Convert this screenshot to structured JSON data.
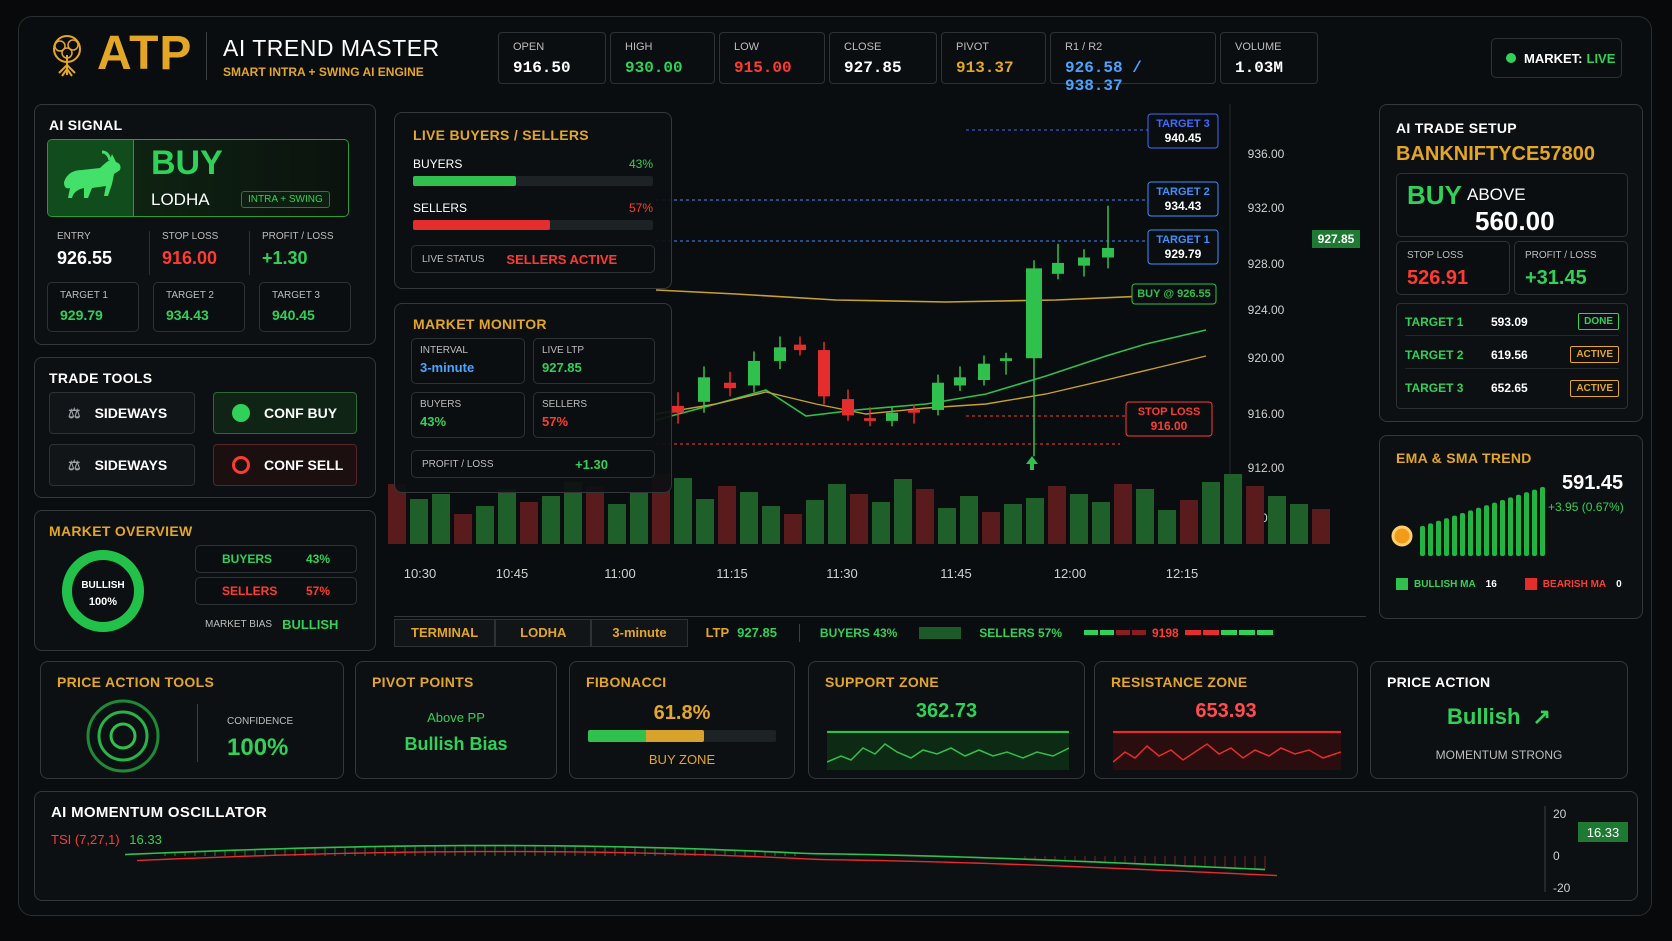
{
  "header": {
    "logo": "ATP",
    "title": "AI TREND MASTER",
    "subtitle": "SMART INTRA + SWING AI ENGINE",
    "stats": [
      {
        "label": "OPEN",
        "value": "916.50",
        "color": "#ffffff"
      },
      {
        "label": "HIGH",
        "value": "930.00",
        "color": "#30d158"
      },
      {
        "label": "LOW",
        "value": "915.00",
        "color": "#ff3b30"
      },
      {
        "label": "CLOSE",
        "value": "927.85",
        "color": "#ffffff"
      },
      {
        "label": "PIVOT",
        "value": "913.37",
        "color": "#e3a625"
      },
      {
        "label": "R1 / R2",
        "value": "926.58 / 938.37",
        "color": "#4aa3ff"
      },
      {
        "label": "VOLUME",
        "value": "1.03M",
        "color": "#ffffff"
      }
    ],
    "market_label": "MARKET:",
    "market_status": "LIVE"
  },
  "ai_signal": {
    "title": "AI SIGNAL",
    "signal": "BUY",
    "symbol": "LODHA",
    "mode": "INTRA + SWING",
    "entry_label": "ENTRY",
    "entry": "926.55",
    "sl_label": "STOP LOSS",
    "sl": "916.00",
    "pl_label": "PROFIT / LOSS",
    "pl": "+1.30",
    "targets": [
      {
        "label": "TARGET 1",
        "value": "929.79"
      },
      {
        "label": "TARGET 2",
        "value": "934.43"
      },
      {
        "label": "TARGET 3",
        "value": "940.45"
      }
    ]
  },
  "trade_tools": {
    "title": "TRADE TOOLS",
    "buttons": [
      "SIDEWAYS",
      "CONF BUY",
      "SIDEWAYS",
      "CONF SELL"
    ]
  },
  "market_overview": {
    "title": "MARKET OVERVIEW",
    "gauge_label": "BULLISH",
    "gauge_value": "100%",
    "gauge_fraction": 1.0,
    "buyers_label": "BUYERS",
    "buyers": "43%",
    "sellers_label": "SELLERS",
    "sellers": "57%",
    "bias_label": "MARKET BIAS",
    "bias": "BULLISH"
  },
  "live_bs": {
    "title": "LIVE BUYERS / SELLERS",
    "buyers_label": "BUYERS",
    "buyers": "43%",
    "buyers_fraction": 0.43,
    "sellers_label": "SELLERS",
    "sellers": "57%",
    "sellers_fraction": 0.57,
    "status_label": "LIVE STATUS",
    "status": "SELLERS ACTIVE"
  },
  "monitor": {
    "title": "MARKET MONITOR",
    "interval_label": "INTERVAL",
    "interval": "3-minute",
    "ltp_label": "LIVE LTP",
    "ltp": "927.85",
    "buyers_label": "BUYERS",
    "buyers": "43%",
    "sellers_label": "SELLERS",
    "sellers": "57%",
    "pl_label": "PROFIT / LOSS",
    "pl": "+1.30"
  },
  "chart_data": {
    "type": "candlestick",
    "y_ticks": [
      "936.00",
      "932.00",
      "928.00",
      "924.00",
      "920.00",
      "916.00",
      "912.00",
      "910.00"
    ],
    "x_ticks": [
      "10:30",
      "10:45",
      "11:00",
      "11:15",
      "11:30",
      "11:45",
      "12:00",
      "12:15"
    ],
    "ltp_tag": "927.85",
    "levels": [
      {
        "label": "TARGET 3",
        "value": "940.45",
        "color": "#4aa3ff"
      },
      {
        "label": "TARGET 2",
        "value": "934.43",
        "color": "#4aa3ff"
      },
      {
        "label": "TARGET 1",
        "value": "929.79",
        "color": "#4aa3ff"
      },
      {
        "label": "BUY @ 926.55",
        "value": "",
        "color": "#30d158"
      },
      {
        "label": "STOP LOSS",
        "value": "916.00",
        "color": "#ff3b30"
      }
    ],
    "candles": [
      [
        917.5,
        918.5,
        916.2,
        917.0
      ],
      [
        917.8,
        920.4,
        917.0,
        919.6
      ],
      [
        919.2,
        920.0,
        918.2,
        918.8
      ],
      [
        919.0,
        921.5,
        918.5,
        920.8
      ],
      [
        920.8,
        922.6,
        920.2,
        921.8
      ],
      [
        922.0,
        922.6,
        921.2,
        921.6
      ],
      [
        921.6,
        922.2,
        917.6,
        918.2
      ],
      [
        918.0,
        918.7,
        916.4,
        916.8
      ],
      [
        916.6,
        917.4,
        916.0,
        916.4
      ],
      [
        916.4,
        917.4,
        916.0,
        917.0
      ],
      [
        917.2,
        917.6,
        916.2,
        917.0
      ],
      [
        917.2,
        919.8,
        916.8,
        919.2
      ],
      [
        919.0,
        920.4,
        918.6,
        919.6
      ],
      [
        919.4,
        921.2,
        919.0,
        920.6
      ],
      [
        920.8,
        921.4,
        919.8,
        921.0
      ],
      [
        921.0,
        928.2,
        913.8,
        927.6
      ],
      [
        927.2,
        929.4,
        926.8,
        928.0
      ],
      [
        927.8,
        929.0,
        927.0,
        928.4
      ],
      [
        928.4,
        932.2,
        927.6,
        929.1
      ]
    ],
    "volume": [
      35,
      60,
      45,
      50,
      30,
      38,
      55,
      42,
      48,
      62,
      58,
      40,
      52,
      70,
      66,
      45,
      58,
      52,
      38,
      30,
      44,
      60,
      50,
      42,
      65,
      55,
      36,
      48,
      32,
      40,
      46,
      58,
      50,
      42,
      60,
      55,
      34,
      44,
      62,
      70,
      58,
      48,
      40,
      35
    ]
  },
  "terminal_bar": {
    "items": [
      "TERMINAL",
      "LODHA",
      "3-minute"
    ],
    "ltp_label": "LTP",
    "ltp": "927.85",
    "buyers": "BUYERS 43%",
    "sellers": "SELLERS 57%",
    "code": "9198"
  },
  "trade_setup": {
    "title": "AI TRADE SETUP",
    "symbol": "BANKNIFTYCE57800",
    "action": "BUY",
    "above_label": "ABOVE",
    "price": "560.00",
    "sl_label": "STOP LOSS",
    "sl": "526.91",
    "pl_label": "PROFIT / LOSS",
    "pl": "+31.45",
    "targets": [
      {
        "label": "TARGET 1",
        "value": "593.09",
        "status": "DONE"
      },
      {
        "label": "TARGET 2",
        "value": "619.56",
        "status": "ACTIVE"
      },
      {
        "label": "TARGET 3",
        "value": "652.65",
        "status": "ACTIVE"
      }
    ]
  },
  "ema": {
    "title": "EMA & SMA TREND",
    "value": "591.45",
    "change": "+3.95 (0.67%)",
    "bullish_label": "BULLISH MA",
    "bullish": "16",
    "bearish_label": "BEARISH MA",
    "bearish": "0"
  },
  "bottom": {
    "price_action_tools": {
      "title": "PRICE ACTION TOOLS",
      "conf_label": "CONFIDENCE",
      "conf": "100%"
    },
    "pivot_points": {
      "title": "PIVOT POINTS",
      "sub": "Above PP",
      "bias": "Bullish Bias"
    },
    "fibonacci": {
      "title": "FIBONACCI",
      "value": "61.8%",
      "fraction": 0.618,
      "zone": "BUY ZONE"
    },
    "support": {
      "title": "SUPPORT ZONE",
      "value": "362.73"
    },
    "resistance": {
      "title": "RESISTANCE ZONE",
      "value": "653.93"
    },
    "price_action": {
      "title": "PRICE ACTION",
      "value": "Bullish",
      "sub": "MOMENTUM STRONG"
    }
  },
  "oscillator": {
    "title": "AI MOMENTUM OSCILLATOR",
    "indicator": "TSI (7,27,1)",
    "value": "16.33",
    "tag": "16.33",
    "y_ticks": [
      "20",
      "0",
      "-20"
    ]
  }
}
